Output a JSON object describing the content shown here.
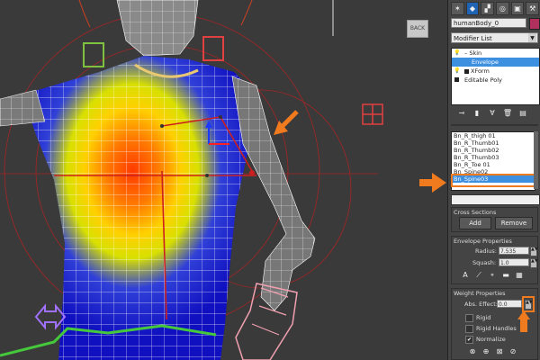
{
  "viewport": {
    "cube_label": "BACK"
  },
  "command_panel": {
    "tabs": [
      "create",
      "modify",
      "hierarchy",
      "motion",
      "display",
      "utilities"
    ],
    "object_name": "humanBody_0",
    "object_color": "#b0315e",
    "modifier_list_label": "Modifier List",
    "stack": [
      {
        "label": "Skin",
        "selected": false
      },
      {
        "label": "Envelope",
        "selected": true
      },
      {
        "label": "XForm",
        "selected": false
      },
      {
        "label": "Editable Poly",
        "selected": false
      }
    ],
    "bones": [
      "Bn_R_thigh 01",
      "Bn_R_Thumb01",
      "Bn_R_Thumb02",
      "Bn_R_Thumb03",
      "Bn_R_Toe 01",
      "Bn_Spine02",
      "Bn_Spine03"
    ],
    "selected_bone_index": 6,
    "cross_sections": {
      "title": "Cross Sections",
      "add_label": "Add",
      "remove_label": "Remove"
    },
    "envelope_properties": {
      "title": "Envelope Properties",
      "radius_label": "Radius:",
      "radius_value": "7.535",
      "squash_label": "Squash:",
      "squash_value": "1.0"
    },
    "weight_properties": {
      "title": "Weight Properties",
      "abs_effect_label": "Abs. Effect:",
      "abs_effect_value": "0.0",
      "rigid_label": "Rigid",
      "rigid_handles_label": "Rigid Handles",
      "normalize_label": "Normalize",
      "normalize_checked": true
    },
    "accent_color": "#f07a1e",
    "selection_color": "#3d8fe0"
  }
}
